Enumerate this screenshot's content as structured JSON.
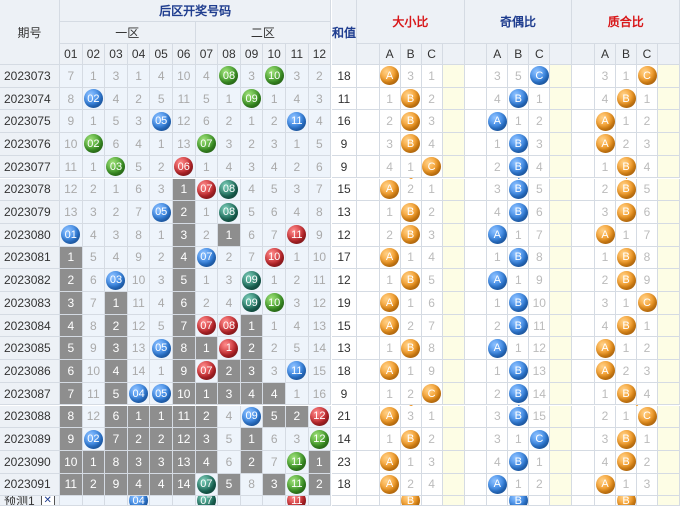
{
  "headers": {
    "period": "期号",
    "back_zone_title": "后区开奖号码",
    "zone1": "一区",
    "zone2": "二区",
    "sum": "和值",
    "size_ratio": "大小比",
    "odd_even_ratio": "奇偶比",
    "prime_ratio": "质合比",
    "numbers": [
      "01",
      "02",
      "03",
      "04",
      "05",
      "06",
      "07",
      "08",
      "09",
      "10",
      "11",
      "12"
    ],
    "abc": [
      "A",
      "B",
      "C"
    ]
  },
  "colors": {
    "blue_ball": "#2f7fe0",
    "green_ball": "#3e9a26",
    "red_ball": "#c4262b",
    "teal_ball": "#1d6e5c",
    "orange_ball": "#f39419",
    "miss_gray": "#8e8e8e",
    "header_bg": "#edf1f6",
    "header_red": "#d8181a",
    "header_blue": "#1f3d8f"
  },
  "rows": [
    {
      "period": "2023073",
      "cells": [
        "7",
        "1",
        "3",
        "1",
        "4",
        "10",
        "4",
        "08",
        "3",
        "10",
        "3",
        "2"
      ],
      "balls": {
        "8": "green",
        "10": "green"
      },
      "miss": [],
      "sum": "18",
      "size": {
        "sel": "A",
        "vals": [
          "A",
          "3",
          "1"
        ]
      },
      "oe": {
        "sel": "C",
        "vals": [
          "3",
          "5",
          "C"
        ]
      },
      "prime": {
        "sel": "C",
        "vals": [
          "3",
          "1",
          "C"
        ]
      }
    },
    {
      "period": "2023074",
      "cells": [
        "8",
        "02",
        "4",
        "2",
        "5",
        "11",
        "5",
        "1",
        "09",
        "1",
        "4",
        "3"
      ],
      "balls": {
        "2": "blue",
        "9": "green"
      },
      "miss": [],
      "sum": "11",
      "size": {
        "sel": "B",
        "vals": [
          "1",
          "B",
          "2"
        ]
      },
      "oe": {
        "sel": "B",
        "vals": [
          "4",
          "B",
          "1"
        ]
      },
      "prime": {
        "sel": "B",
        "vals": [
          "4",
          "B",
          "1"
        ]
      }
    },
    {
      "period": "2023075",
      "cells": [
        "9",
        "1",
        "5",
        "3",
        "05",
        "12",
        "6",
        "2",
        "1",
        "2",
        "11",
        "4"
      ],
      "balls": {
        "5": "blue",
        "11": "blue"
      },
      "miss": [],
      "sum": "16",
      "size": {
        "sel": "B",
        "vals": [
          "2",
          "B",
          "3"
        ]
      },
      "oe": {
        "sel": "A",
        "vals": [
          "A",
          "1",
          "2"
        ]
      },
      "prime": {
        "sel": "A",
        "vals": [
          "A",
          "1",
          "2"
        ]
      }
    },
    {
      "period": "2023076",
      "cells": [
        "10",
        "02",
        "6",
        "4",
        "1",
        "13",
        "07",
        "3",
        "2",
        "3",
        "1",
        "5"
      ],
      "balls": {
        "2": "green",
        "7": "green"
      },
      "miss": [],
      "sum": "9",
      "size": {
        "sel": "B",
        "vals": [
          "3",
          "B",
          "4"
        ]
      },
      "oe": {
        "sel": "B",
        "vals": [
          "1",
          "B",
          "3"
        ]
      },
      "prime": {
        "sel": "A",
        "vals": [
          "A",
          "2",
          "3"
        ]
      }
    },
    {
      "period": "2023077",
      "cells": [
        "11",
        "1",
        "03",
        "5",
        "2",
        "06",
        "1",
        "4",
        "3",
        "4",
        "2",
        "6"
      ],
      "balls": {
        "3": "green",
        "6": "red"
      },
      "miss": [],
      "sum": "9",
      "size": {
        "sel": "C",
        "vals": [
          "4",
          "1",
          "C"
        ]
      },
      "oe": {
        "sel": "B",
        "vals": [
          "2",
          "B",
          "4"
        ]
      },
      "prime": {
        "sel": "B",
        "vals": [
          "1",
          "B",
          "4"
        ]
      }
    },
    {
      "period": "2023078",
      "cells": [
        "12",
        "2",
        "1",
        "6",
        "3",
        "1",
        "07",
        "08",
        "4",
        "5",
        "3",
        "7"
      ],
      "balls": {
        "7": "red",
        "8": "teal"
      },
      "miss": [
        6
      ],
      "sum": "15",
      "size": {
        "sel": "A",
        "vals": [
          "A",
          "2",
          "1"
        ]
      },
      "oe": {
        "sel": "B",
        "vals": [
          "3",
          "B",
          "5"
        ]
      },
      "prime": {
        "sel": "B",
        "vals": [
          "2",
          "B",
          "5"
        ]
      }
    },
    {
      "period": "2023079",
      "cells": [
        "13",
        "3",
        "2",
        "7",
        "05",
        "2",
        "1",
        "08",
        "5",
        "6",
        "4",
        "8"
      ],
      "balls": {
        "5": "blue",
        "8": "teal"
      },
      "miss": [
        6
      ],
      "sum": "13",
      "size": {
        "sel": "B",
        "vals": [
          "1",
          "B",
          "2"
        ]
      },
      "oe": {
        "sel": "B",
        "vals": [
          "4",
          "B",
          "6"
        ]
      },
      "prime": {
        "sel": "B",
        "vals": [
          "3",
          "B",
          "6"
        ]
      }
    },
    {
      "period": "2023080",
      "cells": [
        "01",
        "4",
        "3",
        "8",
        "1",
        "3",
        "2",
        "1",
        "6",
        "7",
        "11",
        "9"
      ],
      "balls": {
        "1": "blue",
        "11": "red"
      },
      "miss": [
        6,
        8
      ],
      "sum": "12",
      "size": {
        "sel": "B",
        "vals": [
          "2",
          "B",
          "3"
        ]
      },
      "oe": {
        "sel": "A",
        "vals": [
          "A",
          "1",
          "7"
        ]
      },
      "prime": {
        "sel": "A",
        "vals": [
          "A",
          "1",
          "7"
        ]
      }
    },
    {
      "period": "2023081",
      "cells": [
        "1",
        "5",
        "4",
        "9",
        "2",
        "4",
        "07",
        "2",
        "7",
        "10",
        "1",
        "10"
      ],
      "balls": {
        "7": "blue",
        "10": "red"
      },
      "miss": [
        1,
        6
      ],
      "sum": "17",
      "size": {
        "sel": "A",
        "vals": [
          "A",
          "1",
          "4"
        ]
      },
      "oe": {
        "sel": "B",
        "vals": [
          "1",
          "B",
          "8"
        ]
      },
      "prime": {
        "sel": "B",
        "vals": [
          "1",
          "B",
          "8"
        ]
      }
    },
    {
      "period": "2023082",
      "cells": [
        "2",
        "6",
        "03",
        "10",
        "3",
        "5",
        "1",
        "3",
        "09",
        "1",
        "2",
        "11"
      ],
      "balls": {
        "3": "blue",
        "9": "teal"
      },
      "miss": [
        1,
        6
      ],
      "sum": "12",
      "size": {
        "sel": "B",
        "vals": [
          "1",
          "B",
          "5"
        ]
      },
      "oe": {
        "sel": "A",
        "vals": [
          "A",
          "1",
          "9"
        ]
      },
      "prime": {
        "sel": "B",
        "vals": [
          "2",
          "B",
          "9"
        ]
      }
    },
    {
      "period": "2023083",
      "cells": [
        "3",
        "7",
        "1",
        "11",
        "4",
        "6",
        "2",
        "4",
        "09",
        "10",
        "3",
        "12"
      ],
      "balls": {
        "9": "teal",
        "10": "green"
      },
      "miss": [
        1,
        3,
        6
      ],
      "sum": "19",
      "size": {
        "sel": "A",
        "vals": [
          "A",
          "1",
          "6"
        ]
      },
      "oe": {
        "sel": "B",
        "vals": [
          "1",
          "B",
          "10"
        ]
      },
      "prime": {
        "sel": "C",
        "vals": [
          "3",
          "1",
          "C"
        ]
      }
    },
    {
      "period": "2023084",
      "cells": [
        "4",
        "8",
        "2",
        "12",
        "5",
        "7",
        "07",
        "08",
        "1",
        "1",
        "4",
        "13"
      ],
      "balls": {
        "7": "red",
        "8": "red"
      },
      "miss": [
        1,
        3,
        6,
        9
      ],
      "sum": "15",
      "size": {
        "sel": "A",
        "vals": [
          "A",
          "2",
          "7"
        ]
      },
      "oe": {
        "sel": "B",
        "vals": [
          "2",
          "B",
          "11"
        ]
      },
      "prime": {
        "sel": "B",
        "vals": [
          "4",
          "B",
          "1"
        ]
      }
    },
    {
      "period": "2023085",
      "cells": [
        "5",
        "9",
        "3",
        "13",
        "05",
        "8",
        "1",
        "1",
        "2",
        "2",
        "5",
        "14"
      ],
      "balls": {
        "5": "blue",
        "8": "red"
      },
      "miss": [
        1,
        3,
        6,
        7,
        9
      ],
      "sum": "13",
      "size": {
        "sel": "B",
        "vals": [
          "1",
          "B",
          "8"
        ]
      },
      "oe": {
        "sel": "A",
        "vals": [
          "A",
          "1",
          "12"
        ]
      },
      "prime": {
        "sel": "A",
        "vals": [
          "A",
          "1",
          "2"
        ]
      }
    },
    {
      "period": "2023086",
      "cells": [
        "6",
        "10",
        "4",
        "14",
        "1",
        "9",
        "07",
        "2",
        "3",
        "3",
        "11",
        "15"
      ],
      "balls": {
        "7": "red",
        "11": "blue"
      },
      "miss": [
        1,
        3,
        6,
        8,
        9
      ],
      "sum": "18",
      "size": {
        "sel": "A",
        "vals": [
          "A",
          "1",
          "9"
        ]
      },
      "oe": {
        "sel": "B",
        "vals": [
          "1",
          "B",
          "13"
        ]
      },
      "prime": {
        "sel": "A",
        "vals": [
          "A",
          "2",
          "3"
        ]
      }
    },
    {
      "period": "2023087",
      "cells": [
        "7",
        "11",
        "5",
        "04",
        "05",
        "10",
        "1",
        "3",
        "4",
        "4",
        "1",
        "16"
      ],
      "balls": {
        "4": "blue",
        "5": "blue"
      },
      "miss": [
        1,
        3,
        6,
        7,
        8,
        9,
        10
      ],
      "sum": "9",
      "size": {
        "sel": "C",
        "vals": [
          "1",
          "2",
          "C"
        ]
      },
      "oe": {
        "sel": "B",
        "vals": [
          "2",
          "B",
          "14"
        ]
      },
      "prime": {
        "sel": "B",
        "vals": [
          "1",
          "B",
          "4"
        ]
      }
    },
    {
      "period": "2023088",
      "cells": [
        "8",
        "12",
        "6",
        "1",
        "1",
        "11",
        "2",
        "4",
        "09",
        "5",
        "2",
        "12"
      ],
      "balls": {
        "9": "blue",
        "12": "red"
      },
      "miss": [
        1,
        3,
        4,
        5,
        6,
        7,
        10,
        11
      ],
      "sum": "21",
      "size": {
        "sel": "A",
        "vals": [
          "A",
          "3",
          "1"
        ]
      },
      "oe": {
        "sel": "B",
        "vals": [
          "3",
          "B",
          "15"
        ]
      },
      "prime": {
        "sel": "C",
        "vals": [
          "2",
          "1",
          "C"
        ]
      }
    },
    {
      "period": "2023089",
      "cells": [
        "9",
        "02",
        "7",
        "2",
        "2",
        "12",
        "3",
        "5",
        "1",
        "6",
        "3",
        "12"
      ],
      "balls": {
        "2": "blue",
        "12": "green"
      },
      "miss": [
        1,
        3,
        4,
        5,
        6,
        7,
        9
      ],
      "sum": "14",
      "size": {
        "sel": "B",
        "vals": [
          "1",
          "B",
          "2"
        ]
      },
      "oe": {
        "sel": "C",
        "vals": [
          "3",
          "1",
          "C"
        ]
      },
      "prime": {
        "sel": "B",
        "vals": [
          "3",
          "B",
          "1"
        ]
      }
    },
    {
      "period": "2023090",
      "cells": [
        "10",
        "1",
        "8",
        "3",
        "3",
        "13",
        "4",
        "6",
        "2",
        "7",
        "11",
        "1"
      ],
      "balls": {
        "11": "green"
      },
      "miss": [
        1,
        2,
        3,
        4,
        5,
        6,
        7,
        9,
        12
      ],
      "sum": "23",
      "size": {
        "sel": "A",
        "vals": [
          "A",
          "1",
          "3"
        ]
      },
      "oe": {
        "sel": "B",
        "vals": [
          "4",
          "B",
          "1"
        ]
      },
      "prime": {
        "sel": "B",
        "vals": [
          "4",
          "B",
          "2"
        ]
      }
    },
    {
      "period": "2023091",
      "cells": [
        "11",
        "2",
        "9",
        "4",
        "4",
        "14",
        "07",
        "5",
        "8",
        "3",
        "11",
        "2"
      ],
      "balls": {
        "7": "teal",
        "11": "green"
      },
      "miss": [
        1,
        2,
        3,
        4,
        5,
        6,
        8,
        10,
        12
      ],
      "sum": "18",
      "size": {
        "sel": "A",
        "vals": [
          "A",
          "2",
          "4"
        ]
      },
      "oe": {
        "sel": "A",
        "vals": [
          "A",
          "1",
          "2"
        ]
      },
      "prime": {
        "sel": "A",
        "vals": [
          "A",
          "1",
          "3"
        ]
      }
    }
  ],
  "prediction": {
    "label": "预测1",
    "close": "✕",
    "balls": [
      {
        "col": 4,
        "text": "04",
        "color": "blue"
      },
      {
        "col": 7,
        "text": "07",
        "color": "teal"
      },
      {
        "col": 11,
        "text": "11",
        "color": "red"
      }
    ],
    "size_sel": "B",
    "oe_sel": "B",
    "prime_sel": "B"
  }
}
